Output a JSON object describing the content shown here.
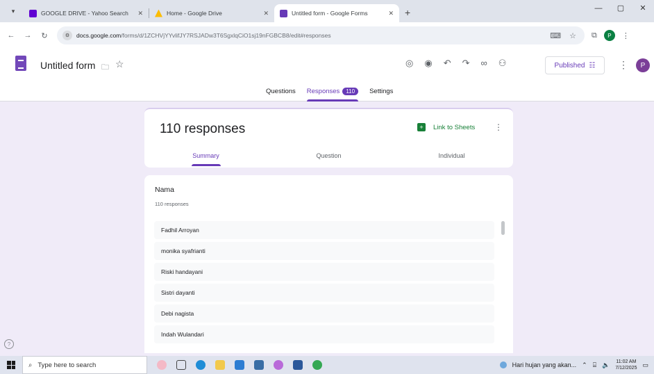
{
  "browser": {
    "tabs": [
      {
        "title": "GOOGLE DRIVE - Yahoo Search",
        "favicon_color": "#6001d2",
        "active": false
      },
      {
        "title": "Home - Google Drive",
        "favicon_color": "#fbbc04",
        "active": false
      },
      {
        "title": "Untitled form - Google Forms",
        "favicon_color": "#673ab7",
        "active": true
      }
    ],
    "url_domain": "docs.google.com",
    "url_path": "/forms/d/1ZCHVjYYvlifJY7RSJADw3T6SgxlqCiO1sj19nFGBCB8/edit#responses",
    "profile_initial": "P"
  },
  "form": {
    "title": "Untitled form",
    "published_label": "Published",
    "avatar_initial": "P",
    "tabs": {
      "questions": "Questions",
      "responses": "Responses",
      "responses_count": "110",
      "settings": "Settings"
    }
  },
  "summary": {
    "heading": "110 responses",
    "link_sheets": "Link to Sheets",
    "subtabs": [
      "Summary",
      "Question",
      "Individual"
    ]
  },
  "question": {
    "title": "Nama",
    "subtitle": "110 responses",
    "answers": [
      "Fadhil Arroyan",
      "monika syafrianti",
      "Riski handayani",
      "Sistri dayanti",
      "Debi nagista",
      "Indah Wulandari"
    ]
  },
  "taskbar": {
    "search_placeholder": "Type here to search",
    "weather": "Hari hujan yang akan...",
    "time": "11:02 AM",
    "date": "7/12/2025"
  },
  "colors": {
    "accent": "#673ab7",
    "sheets_green": "#188038",
    "background": "#f0ebf8"
  }
}
